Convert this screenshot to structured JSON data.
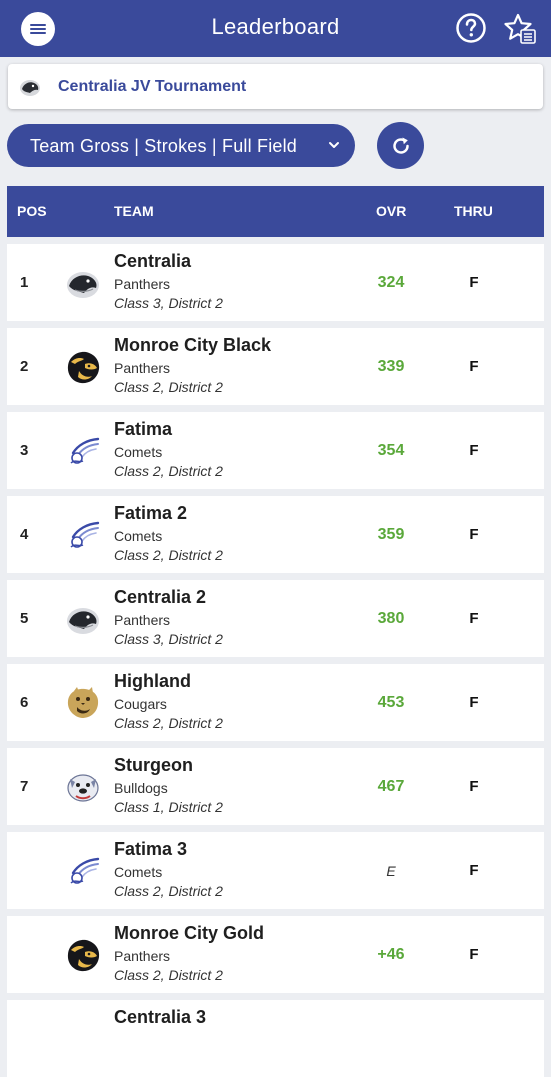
{
  "header": {
    "title": "Leaderboard"
  },
  "tournament": {
    "name": "Centralia JV Tournament"
  },
  "filter": {
    "label": "Team Gross | Strokes | Full Field"
  },
  "columns": {
    "pos": "POS",
    "team": "TEAM",
    "ovr": "OVR",
    "thru": "THRU"
  },
  "colors": {
    "primary": "#3a4a9b",
    "score_green": "#5aa83a"
  },
  "rows": [
    {
      "pos": "1",
      "name": "Centralia",
      "mascot": "Panthers",
      "cls": "Class 3, District 2",
      "ovr": "324",
      "thru": "F",
      "logo": "panther-icon"
    },
    {
      "pos": "2",
      "name": "Monroe City Black",
      "mascot": "Panthers",
      "cls": "Class 2, District 2",
      "ovr": "339",
      "thru": "F",
      "logo": "panther-gold-icon"
    },
    {
      "pos": "3",
      "name": "Fatima",
      "mascot": "Comets",
      "cls": "Class 2, District 2",
      "ovr": "354",
      "thru": "F",
      "logo": "comet-icon"
    },
    {
      "pos": "4",
      "name": "Fatima 2",
      "mascot": "Comets",
      "cls": "Class 2, District 2",
      "ovr": "359",
      "thru": "F",
      "logo": "comet-icon"
    },
    {
      "pos": "5",
      "name": "Centralia 2",
      "mascot": "Panthers",
      "cls": "Class 3, District 2",
      "ovr": "380",
      "thru": "F",
      "logo": "panther-icon"
    },
    {
      "pos": "6",
      "name": "Highland",
      "mascot": "Cougars",
      "cls": "Class 2, District 2",
      "ovr": "453",
      "thru": "F",
      "logo": "cougar-icon"
    },
    {
      "pos": "7",
      "name": "Sturgeon",
      "mascot": "Bulldogs",
      "cls": "Class 1, District 2",
      "ovr": "467",
      "thru": "F",
      "logo": "bulldog-icon"
    },
    {
      "pos": "",
      "name": "Fatima 3",
      "mascot": "Comets",
      "cls": "Class 2, District 2",
      "ovr": "E",
      "thru": "F",
      "logo": "comet-icon"
    },
    {
      "pos": "",
      "name": "Monroe City Gold",
      "mascot": "Panthers",
      "cls": "Class 2, District 2",
      "ovr": "+46",
      "thru": "F",
      "logo": "panther-gold-icon"
    },
    {
      "pos": "",
      "name": "Centralia 3",
      "mascot": "",
      "cls": "",
      "ovr": "",
      "thru": "",
      "logo": ""
    }
  ]
}
